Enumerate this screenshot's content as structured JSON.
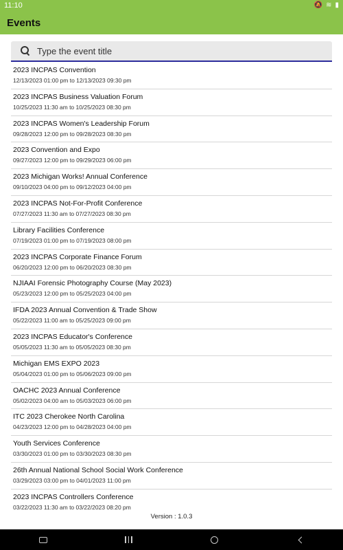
{
  "status_bar": {
    "time": "11:10",
    "icons": [
      "mute-icon",
      "wifi-icon",
      "battery-icon"
    ]
  },
  "header": {
    "title": "Events"
  },
  "search": {
    "placeholder": "Type the event title"
  },
  "events": [
    {
      "title": "2023 INCPAS Convention",
      "dates": "12/13/2023 01:00 pm to 12/13/2023 09:30 pm"
    },
    {
      "title": "2023 INCPAS Business Valuation Forum",
      "dates": "10/25/2023 11:30 am to 10/25/2023 08:30 pm"
    },
    {
      "title": "2023 INCPAS Women's Leadership Forum",
      "dates": "09/28/2023 12:00 pm to 09/28/2023 08:30 pm"
    },
    {
      "title": "2023 Convention and Expo",
      "dates": "09/27/2023 12:00 pm to 09/29/2023 06:00 pm"
    },
    {
      "title": "2023 Michigan Works! Annual Conference",
      "dates": "09/10/2023 04:00 pm to 09/12/2023 04:00 pm"
    },
    {
      "title": "2023 INCPAS Not-For-Profit Conference",
      "dates": "07/27/2023 11:30 am to 07/27/2023 08:30 pm"
    },
    {
      "title": "Library Facilities Conference",
      "dates": "07/19/2023 01:00 pm to 07/19/2023 08:00 pm"
    },
    {
      "title": "2023 INCPAS Corporate Finance Forum",
      "dates": "06/20/2023 12:00 pm to 06/20/2023 08:30 pm"
    },
    {
      "title": "NJIAAI Forensic Photography Course (May 2023)",
      "dates": "05/23/2023 12:00 pm to 05/25/2023 04:00 pm"
    },
    {
      "title": "IFDA 2023 Annual Convention & Trade Show",
      "dates": "05/22/2023 11:00 am to 05/25/2023 09:00 pm"
    },
    {
      "title": "2023 INCPAS Educator's Conference",
      "dates": "05/05/2023 11:30 am to 05/05/2023 08:30 pm"
    },
    {
      "title": "Michigan EMS EXPO 2023",
      "dates": "05/04/2023 01:00 pm to 05/06/2023 09:00 pm"
    },
    {
      "title": "OACHC 2023 Annual Conference",
      "dates": "05/02/2023 04:00 am to 05/03/2023 06:00 pm"
    },
    {
      "title": "ITC 2023 Cherokee North Carolina",
      "dates": "04/23/2023 12:00 pm to 04/28/2023 04:00 pm"
    },
    {
      "title": "Youth Services Conference",
      "dates": "03/30/2023 01:00 pm to 03/30/2023 08:30 pm"
    },
    {
      "title": "26th Annual National School Social Work Conference",
      "dates": "03/29/2023 03:00 pm to 04/01/2023 11:00 pm"
    },
    {
      "title": "2023 INCPAS Controllers Conference",
      "dates": "03/22/2023 11:30 am to 03/22/2023 08:20 pm"
    }
  ],
  "footer": {
    "version": "Version : 1.0.3"
  },
  "nav_bar": {
    "icons": [
      "keyboard-icon",
      "recents-icon",
      "home-icon",
      "back-icon"
    ]
  },
  "colors": {
    "accent": "#8bc34a",
    "search_underline": "#2c2c9c",
    "nav_bar": "#000000"
  }
}
